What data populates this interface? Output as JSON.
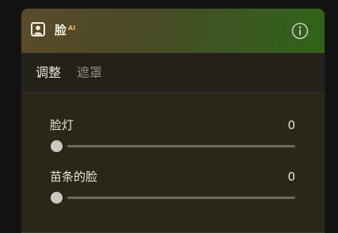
{
  "panel": {
    "title": "脸",
    "ai_badge": "AI",
    "header_icon": "face-portrait-icon",
    "info_icon": "info-icon"
  },
  "tabs": [
    {
      "label": "调整",
      "active": true
    },
    {
      "label": "遮罩",
      "active": false
    }
  ],
  "sliders": [
    {
      "label": "脸灯",
      "value": "0",
      "level": 0
    },
    {
      "label": "苗条的脸",
      "value": "0",
      "level": 0
    }
  ],
  "colors": {
    "header_gradient_start": "#5a4a2a",
    "header_gradient_end": "#2e6418",
    "ai_badge": "#e8b27a",
    "track": "#6d6a62",
    "thumb": "#c9c8c5"
  }
}
